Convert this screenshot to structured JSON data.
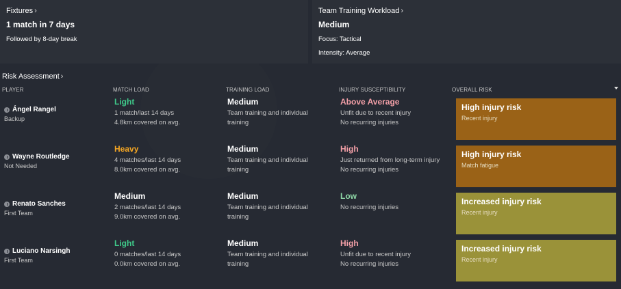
{
  "fixtures": {
    "title": "Fixtures",
    "headline": "1 match in 7 days",
    "detail": "Followed by 8-day break"
  },
  "training": {
    "title": "Team Training Workload",
    "headline": "Medium",
    "focus": "Focus: Tactical",
    "intensity": "Intensity: Average"
  },
  "risk_assessment": {
    "title": "Risk Assessment",
    "columns": {
      "player": "PLAYER",
      "match_load": "MATCH LOAD",
      "training_load": "TRAINING LOAD",
      "injury_susceptibility": "INJURY SUSCEPTIBILITY",
      "overall_risk": "OVERALL RISK"
    },
    "rows": [
      {
        "name": "Ángel Rangel",
        "role": "Backup",
        "match_load": "Light",
        "match_color": "#3fc98a",
        "match_line1": "1 match/last 14 days",
        "match_line2": "4.8km covered on avg.",
        "training_load": "Medium",
        "training_line1": "Team training and individual",
        "training_line2": "training",
        "susc": "Above Average",
        "susc_color": "#f4a0a8",
        "susc_line1": "Unfit due to recent injury",
        "susc_line2": "No recurring injuries",
        "risk": "High injury risk",
        "risk_sub": "Recent injury",
        "risk_color": "#9a6217"
      },
      {
        "name": "Wayne Routledge",
        "role": "Not Needed",
        "match_load": "Heavy",
        "match_color": "#f5a623",
        "match_line1": "4 matches/last 14 days",
        "match_line2": "8.0km covered on avg.",
        "training_load": "Medium",
        "training_line1": "Team training and individual",
        "training_line2": "training",
        "susc": "High",
        "susc_color": "#f4a0a8",
        "susc_line1": "Just returned from long-term injury",
        "susc_line2": "No recurring injuries",
        "risk": "High injury risk",
        "risk_sub": "Match fatigue",
        "risk_color": "#9a6217"
      },
      {
        "name": "Renato Sanches",
        "role": "First Team",
        "match_load": "Medium",
        "match_color": "#ffffff",
        "match_line1": "2 matches/last 14 days",
        "match_line2": "9.0km covered on avg.",
        "training_load": "Medium",
        "training_line1": "Team training and individual",
        "training_line2": "training",
        "susc": "Low",
        "susc_color": "#8fd9a8",
        "susc_line1": "No recurring injuries",
        "susc_line2": "",
        "risk": "Increased injury risk",
        "risk_sub": "Recent injury",
        "risk_color": "#9a9239"
      },
      {
        "name": "Luciano Narsingh",
        "role": "First Team",
        "match_load": "Light",
        "match_color": "#3fc98a",
        "match_line1": "0 matches/last 14 days",
        "match_line2": "0.0km covered on avg.",
        "training_load": "Medium",
        "training_line1": "Team training and individual",
        "training_line2": "training",
        "susc": "High",
        "susc_color": "#f4a0a8",
        "susc_line1": "Unfit due to recent injury",
        "susc_line2": "No recurring injuries",
        "risk": "Increased injury risk",
        "risk_sub": "Recent injury",
        "risk_color": "#9a9239"
      }
    ]
  }
}
